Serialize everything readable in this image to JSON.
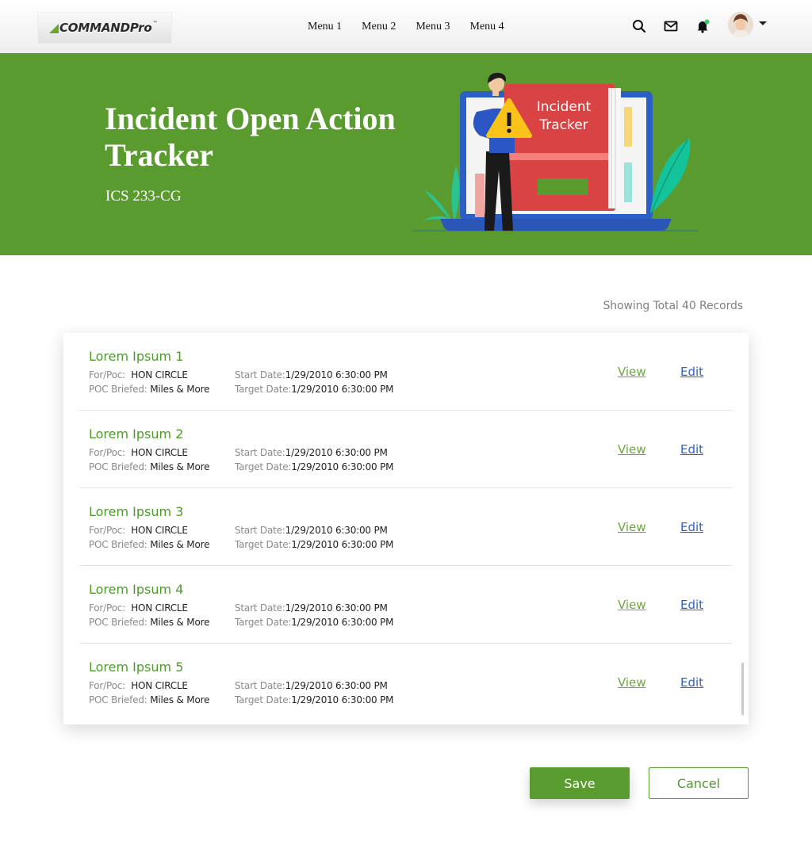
{
  "brand": {
    "logo_text_command": "COMMAND",
    "logo_text_pro": "Pro",
    "logo_tm": "™"
  },
  "nav": {
    "menu": [
      "Menu 1",
      "Menu 2",
      "Menu 3",
      "Menu 4"
    ],
    "icons": [
      "search-icon",
      "mail-icon",
      "bell-icon",
      "avatar",
      "chevron-down-icon"
    ],
    "notification_dot_color": "#2bd35a"
  },
  "hero": {
    "title": "Incident Open Action Tracker",
    "subtitle": "ICS 233-CG",
    "illustration_book_text_line1": "Incident",
    "illustration_book_text_line2": "Tracker",
    "background_color": "#5a9b30"
  },
  "records": {
    "summary": "Showing Total 40 Records",
    "labels": {
      "for_poc": "For/Poc:",
      "poc_briefed": "POC Briefed:",
      "start_date": "Start Date:",
      "target_date": "Target Date:",
      "view": "View",
      "edit": "Edit"
    },
    "items": [
      {
        "title": "Lorem Ipsum 1",
        "for_poc": "HON CIRCLE",
        "poc_briefed": "Miles & More",
        "start_date": "1/29/2010 6:30:00 PM",
        "target_date": "1/29/2010 6:30:00 PM"
      },
      {
        "title": "Lorem Ipsum 2",
        "for_poc": "HON CIRCLE",
        "poc_briefed": "Miles & More",
        "start_date": "1/29/2010 6:30:00 PM",
        "target_date": "1/29/2010 6:30:00 PM"
      },
      {
        "title": "Lorem Ipsum 3",
        "for_poc": "HON CIRCLE",
        "poc_briefed": "Miles & More",
        "start_date": "1/29/2010 6:30:00 PM",
        "target_date": "1/29/2010 6:30:00 PM"
      },
      {
        "title": "Lorem Ipsum 4",
        "for_poc": "HON CIRCLE",
        "poc_briefed": "Miles & More",
        "start_date": "1/29/2010 6:30:00 PM",
        "target_date": "1/29/2010 6:30:00 PM"
      },
      {
        "title": "Lorem Ipsum 5",
        "for_poc": "HON CIRCLE",
        "poc_briefed": "Miles & More",
        "start_date": "1/29/2010 6:30:00 PM",
        "target_date": "1/29/2010 6:30:00 PM"
      }
    ]
  },
  "actions": {
    "save": "Save",
    "cancel": "Cancel"
  },
  "colors": {
    "accent_green": "#5a9b30",
    "title_green": "#4f9a2f",
    "view_link": "#6aa93a",
    "edit_link": "#2f62c7"
  }
}
